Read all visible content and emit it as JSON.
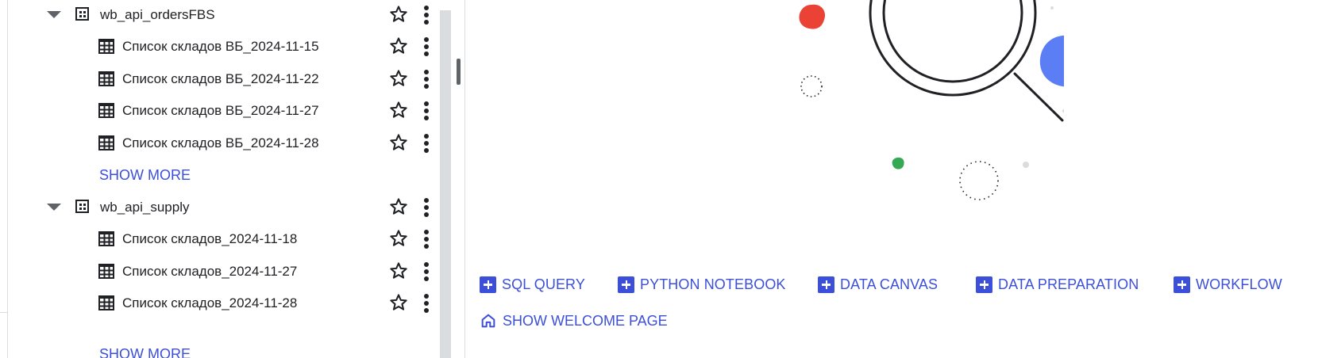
{
  "tree": {
    "datasets": [
      {
        "name": "wb_api_ordersFBS",
        "tables": [
          "Список складов ВБ_2024-11-15",
          "Список складов ВБ_2024-11-22",
          "Список складов ВБ_2024-11-27",
          "Список складов ВБ_2024-11-28"
        ],
        "show_more": "SHOW MORE"
      },
      {
        "name": "wb_api_supply",
        "tables": [
          "Список складов_2024-11-18",
          "Список складов_2024-11-27",
          "Список складов_2024-11-28"
        ],
        "show_more": "SHOW MORE"
      }
    ],
    "icons": {
      "expand": "arrow-drop-down-icon",
      "dataset": "dataset-icon",
      "table": "table-icon",
      "star": "star-outline-icon",
      "more": "more-vert-icon"
    }
  },
  "welcome": {
    "actions": [
      "SQL QUERY",
      "PYTHON NOTEBOOK",
      "DATA CANVAS",
      "DATA PREPARATION",
      "WORKFLOW"
    ],
    "show_welcome_label": "SHOW WELCOME PAGE",
    "action_icon": "add-box-icon",
    "welcome_icon": "home-icon"
  },
  "colors": {
    "accent": "#3c4fd9",
    "text": "#202124",
    "red": "#ea4335",
    "blue": "#5b7ef5",
    "green": "#34a853",
    "grey": "#dadce0"
  }
}
